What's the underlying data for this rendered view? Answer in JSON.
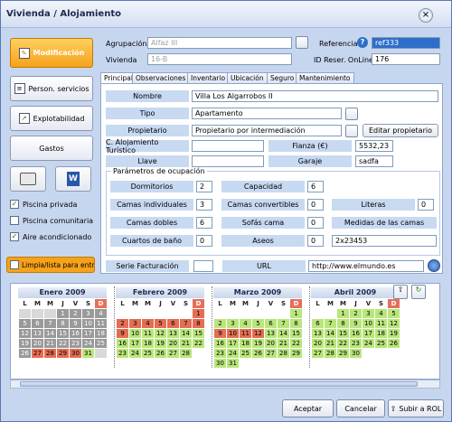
{
  "window": {
    "title": "Vivienda / Alojamiento",
    "close": "×"
  },
  "left": {
    "modificacion": "Modificación",
    "person_servicios": "Person. servicios",
    "explotabilidad": "Explotabilidad",
    "gastos": "Gastos",
    "checks": [
      {
        "label": "Piscina privada",
        "checked": true
      },
      {
        "label": "Piscina comunitaria",
        "checked": false
      },
      {
        "label": "Aire acondicionado",
        "checked": true
      }
    ],
    "limpia": "Limpia/lista para entrar"
  },
  "header": {
    "agrupacion_label": "Agrupación",
    "agrupacion_value": "Alfaz III",
    "vivienda_label": "Vivienda",
    "vivienda_value": "16-B",
    "referencia_label": "Referencia",
    "referencia_value": "ref333",
    "idreser_label": "ID Reser. OnLine",
    "idreser_value": "176"
  },
  "tabs": [
    "Principal",
    "Observaciones",
    "Inventario",
    "Ubicación",
    "Seguro",
    "Mantenimiento"
  ],
  "principal": {
    "nombre_label": "Nombre",
    "nombre": "Villa Los Algarrobos II",
    "tipo_label": "Tipo",
    "tipo": "Apartamento",
    "propietario_label": "Propietario",
    "propietario": "Propietario por intermediación",
    "editar_propietario": "Editar propietario",
    "cat_label": "C. Alojamiento Turístico",
    "cat_value": "",
    "fianza_label": "Fianza (€)",
    "fianza": "5532,23",
    "llave_label": "Llave",
    "llave": "",
    "garaje_label": "Garaje",
    "garaje": "sadfa",
    "params_title": "Parámetros de ocupación",
    "dormitorios_label": "Dormitorios",
    "dormitorios": "2",
    "capacidad_label": "Capacidad",
    "capacidad": "6",
    "camas_ind_label": "Camas individuales",
    "camas_ind": "3",
    "camas_conv_label": "Camas convertibles",
    "camas_conv": "0",
    "literas_label": "Literas",
    "literas": "0",
    "camas_dobles_label": "Camas dobles",
    "camas_dobles": "6",
    "sofas_label": "Sofás cama",
    "sofas": "0",
    "medidas_label": "Medidas de las camas",
    "medidas": "2x23453",
    "cuartos_label": "Cuartos de baño",
    "cuartos": "0",
    "aseos_label": "Aseos",
    "aseos": "0",
    "serie_label": "Serie Facturación",
    "serie": "",
    "url_label": "URL",
    "url": "http://www.elmundo.es"
  },
  "calendar": {
    "days": [
      "L",
      "M",
      "M",
      "J",
      "V",
      "S",
      "D"
    ],
    "months": [
      {
        "title": "Enero 2009",
        "cells": [
          [
            "",
            "",
            "",
            "1",
            "2",
            "3",
            "4"
          ],
          [
            "5",
            "6",
            "7",
            "8",
            "9",
            "10",
            "11"
          ],
          [
            "12",
            "13",
            "14",
            "15",
            "16",
            "17",
            "18"
          ],
          [
            "19",
            "20",
            "21",
            "22",
            "23",
            "24",
            "25"
          ],
          [
            "26",
            "27",
            "28",
            "29",
            "30",
            "31",
            ""
          ]
        ],
        "colors": [
          [
            "l",
            "l",
            "l",
            "g",
            "g",
            "g",
            "g"
          ],
          [
            "g",
            "g",
            "g",
            "g",
            "g",
            "g",
            "g"
          ],
          [
            "g",
            "g",
            "g",
            "g",
            "g",
            "g",
            "g"
          ],
          [
            "g",
            "g",
            "g",
            "g",
            "g",
            "g",
            "g"
          ],
          [
            "g",
            "r",
            "r",
            "r",
            "r",
            "gr",
            "l"
          ]
        ]
      },
      {
        "title": "Febrero 2009",
        "cells": [
          [
            "",
            "",
            "",
            "",
            "",
            "",
            "1"
          ],
          [
            "2",
            "3",
            "4",
            "5",
            "6",
            "7",
            "8"
          ],
          [
            "9",
            "10",
            "11",
            "12",
            "13",
            "14",
            "15"
          ],
          [
            "16",
            "17",
            "18",
            "19",
            "20",
            "21",
            "22"
          ],
          [
            "23",
            "24",
            "25",
            "26",
            "27",
            "28",
            ""
          ]
        ],
        "colors": [
          [
            "w",
            "w",
            "w",
            "w",
            "w",
            "w",
            "r"
          ],
          [
            "r",
            "r",
            "r",
            "r",
            "r",
            "r",
            "r"
          ],
          [
            "r",
            "gr",
            "gr",
            "gr",
            "gr",
            "gr",
            "gr"
          ],
          [
            "gr",
            "gr",
            "gr",
            "gr",
            "gr",
            "gr",
            "gr"
          ],
          [
            "gr",
            "gr",
            "gr",
            "gr",
            "gr",
            "gr",
            "w"
          ]
        ]
      },
      {
        "title": "Marzo 2009",
        "cells": [
          [
            "",
            "",
            "",
            "",
            "",
            "",
            "1"
          ],
          [
            "2",
            "3",
            "4",
            "5",
            "6",
            "7",
            "8"
          ],
          [
            "9",
            "10",
            "11",
            "12",
            "13",
            "14",
            "15"
          ],
          [
            "16",
            "17",
            "18",
            "19",
            "20",
            "21",
            "22"
          ],
          [
            "23",
            "24",
            "25",
            "26",
            "27",
            "28",
            "29"
          ],
          [
            "30",
            "31",
            "",
            "",
            "",
            "",
            ""
          ]
        ],
        "colors": [
          [
            "w",
            "w",
            "w",
            "w",
            "w",
            "w",
            "gr"
          ],
          [
            "gr",
            "gr",
            "gr",
            "gr",
            "gr",
            "gr",
            "gr"
          ],
          [
            "r",
            "r",
            "r",
            "r",
            "gr",
            "gr",
            "gr"
          ],
          [
            "gr",
            "gr",
            "gr",
            "gr",
            "gr",
            "gr",
            "gr"
          ],
          [
            "gr",
            "gr",
            "gr",
            "gr",
            "gr",
            "gr",
            "gr"
          ],
          [
            "gr",
            "gr",
            "w",
            "w",
            "w",
            "w",
            "w"
          ]
        ]
      },
      {
        "title": "Abril 2009",
        "cells": [
          [
            "",
            "",
            "1",
            "2",
            "3",
            "4",
            "5"
          ],
          [
            "6",
            "7",
            "8",
            "9",
            "10",
            "11",
            "12"
          ],
          [
            "13",
            "14",
            "15",
            "16",
            "17",
            "18",
            "19"
          ],
          [
            "20",
            "21",
            "22",
            "23",
            "24",
            "25",
            "26"
          ],
          [
            "27",
            "28",
            "29",
            "30",
            "",
            "",
            ""
          ]
        ],
        "colors": [
          [
            "w",
            "w",
            "gr",
            "gr",
            "gr",
            "gr",
            "gr"
          ],
          [
            "gr",
            "gr",
            "gr",
            "gr",
            "gr",
            "gr",
            "gr"
          ],
          [
            "gr",
            "gr",
            "gr",
            "gr",
            "gr",
            "gr",
            "gr"
          ],
          [
            "gr",
            "gr",
            "gr",
            "gr",
            "gr",
            "gr",
            "gr"
          ],
          [
            "gr",
            "gr",
            "gr",
            "gr",
            "w",
            "w",
            "w"
          ]
        ]
      }
    ]
  },
  "footer": {
    "aceptar": "Aceptar",
    "cancelar": "Cancelar",
    "subir": "Subir a ROL"
  },
  "colors": {
    "accent": "#f6a21a",
    "title_bg": "#d3def1",
    "label_bg": "#c8d9f2"
  }
}
